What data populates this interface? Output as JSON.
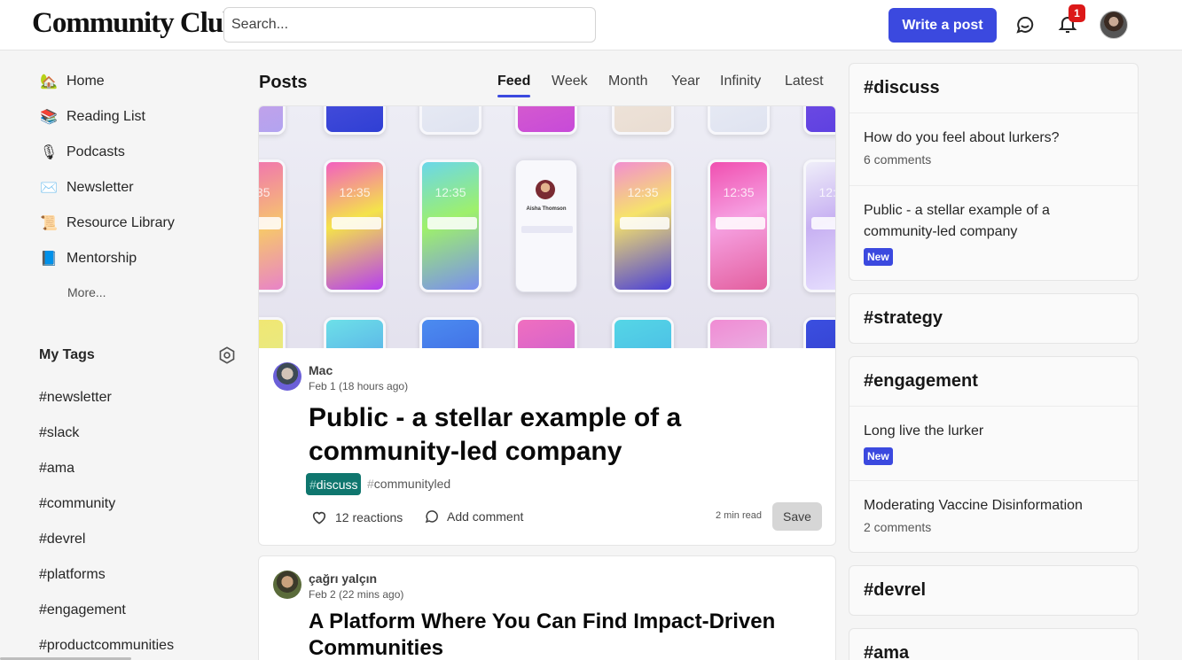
{
  "header": {
    "logo": "Community Club",
    "search_placeholder": "Search...",
    "write_button": "Write a post",
    "notification_count": "1"
  },
  "sidebar": {
    "nav": [
      {
        "label": "Home",
        "icon": "house-icon",
        "emoji": "🏡"
      },
      {
        "label": "Reading List",
        "icon": "reading-list-icon",
        "emoji": "📚"
      },
      {
        "label": "Podcasts",
        "icon": "microphone-icon",
        "emoji": "🎙"
      },
      {
        "label": "Newsletter",
        "icon": "envelope-icon",
        "emoji": "✉️"
      },
      {
        "label": "Resource Library",
        "icon": "scroll-icon",
        "emoji": "📜"
      },
      {
        "label": "Mentorship",
        "icon": "books-icon",
        "emoji": "📘"
      }
    ],
    "more": "More...",
    "my_tags_title": "My Tags",
    "tags": [
      "#newsletter",
      "#slack",
      "#ama",
      "#community",
      "#devrel",
      "#platforms",
      "#engagement",
      "#productcommunities"
    ]
  },
  "feed": {
    "title": "Posts",
    "tabs": [
      "Feed",
      "Week",
      "Month",
      "Year",
      "Infinity",
      "Latest"
    ],
    "active_tab": "Feed",
    "cover_phone_time": "12:35",
    "cover_profile_name": "Aisha Thomson",
    "posts": [
      {
        "author": "Mac",
        "date": "Feb 1 (18 hours ago)",
        "title_line1": "Public - a stellar example of a",
        "title_line2": "community-led company",
        "tag_primary": "discuss",
        "tag_secondary": "communityled",
        "reactions": "12 reactions",
        "comment": "Add comment",
        "read_time": "2 min read",
        "save": "Save"
      },
      {
        "author": "çağrı yalçın",
        "date": "Feb 2 (22 mins ago)",
        "title_line1": "A Platform Where You Can Find Impact-Driven",
        "title_line2": "Communities"
      }
    ]
  },
  "right": {
    "discuss": {
      "title": "#discuss",
      "items": [
        {
          "title": "How do you feel about lurkers?",
          "meta": "6 comments"
        },
        {
          "title": "Public - a stellar example of a community-led company",
          "badge": "New"
        }
      ]
    },
    "strategy": {
      "title": "#strategy"
    },
    "engagement": {
      "title": "#engagement",
      "items": [
        {
          "title": "Long live the lurker",
          "badge": "New"
        },
        {
          "title": "Moderating Vaccine Disinformation",
          "meta": "2 comments"
        }
      ]
    },
    "devrel": {
      "title": "#devrel"
    },
    "ama": {
      "title": "#ama"
    }
  },
  "colors": {
    "accent": "#3b49df",
    "tag_discuss": "#0f766e",
    "notification": "#dc1818"
  }
}
